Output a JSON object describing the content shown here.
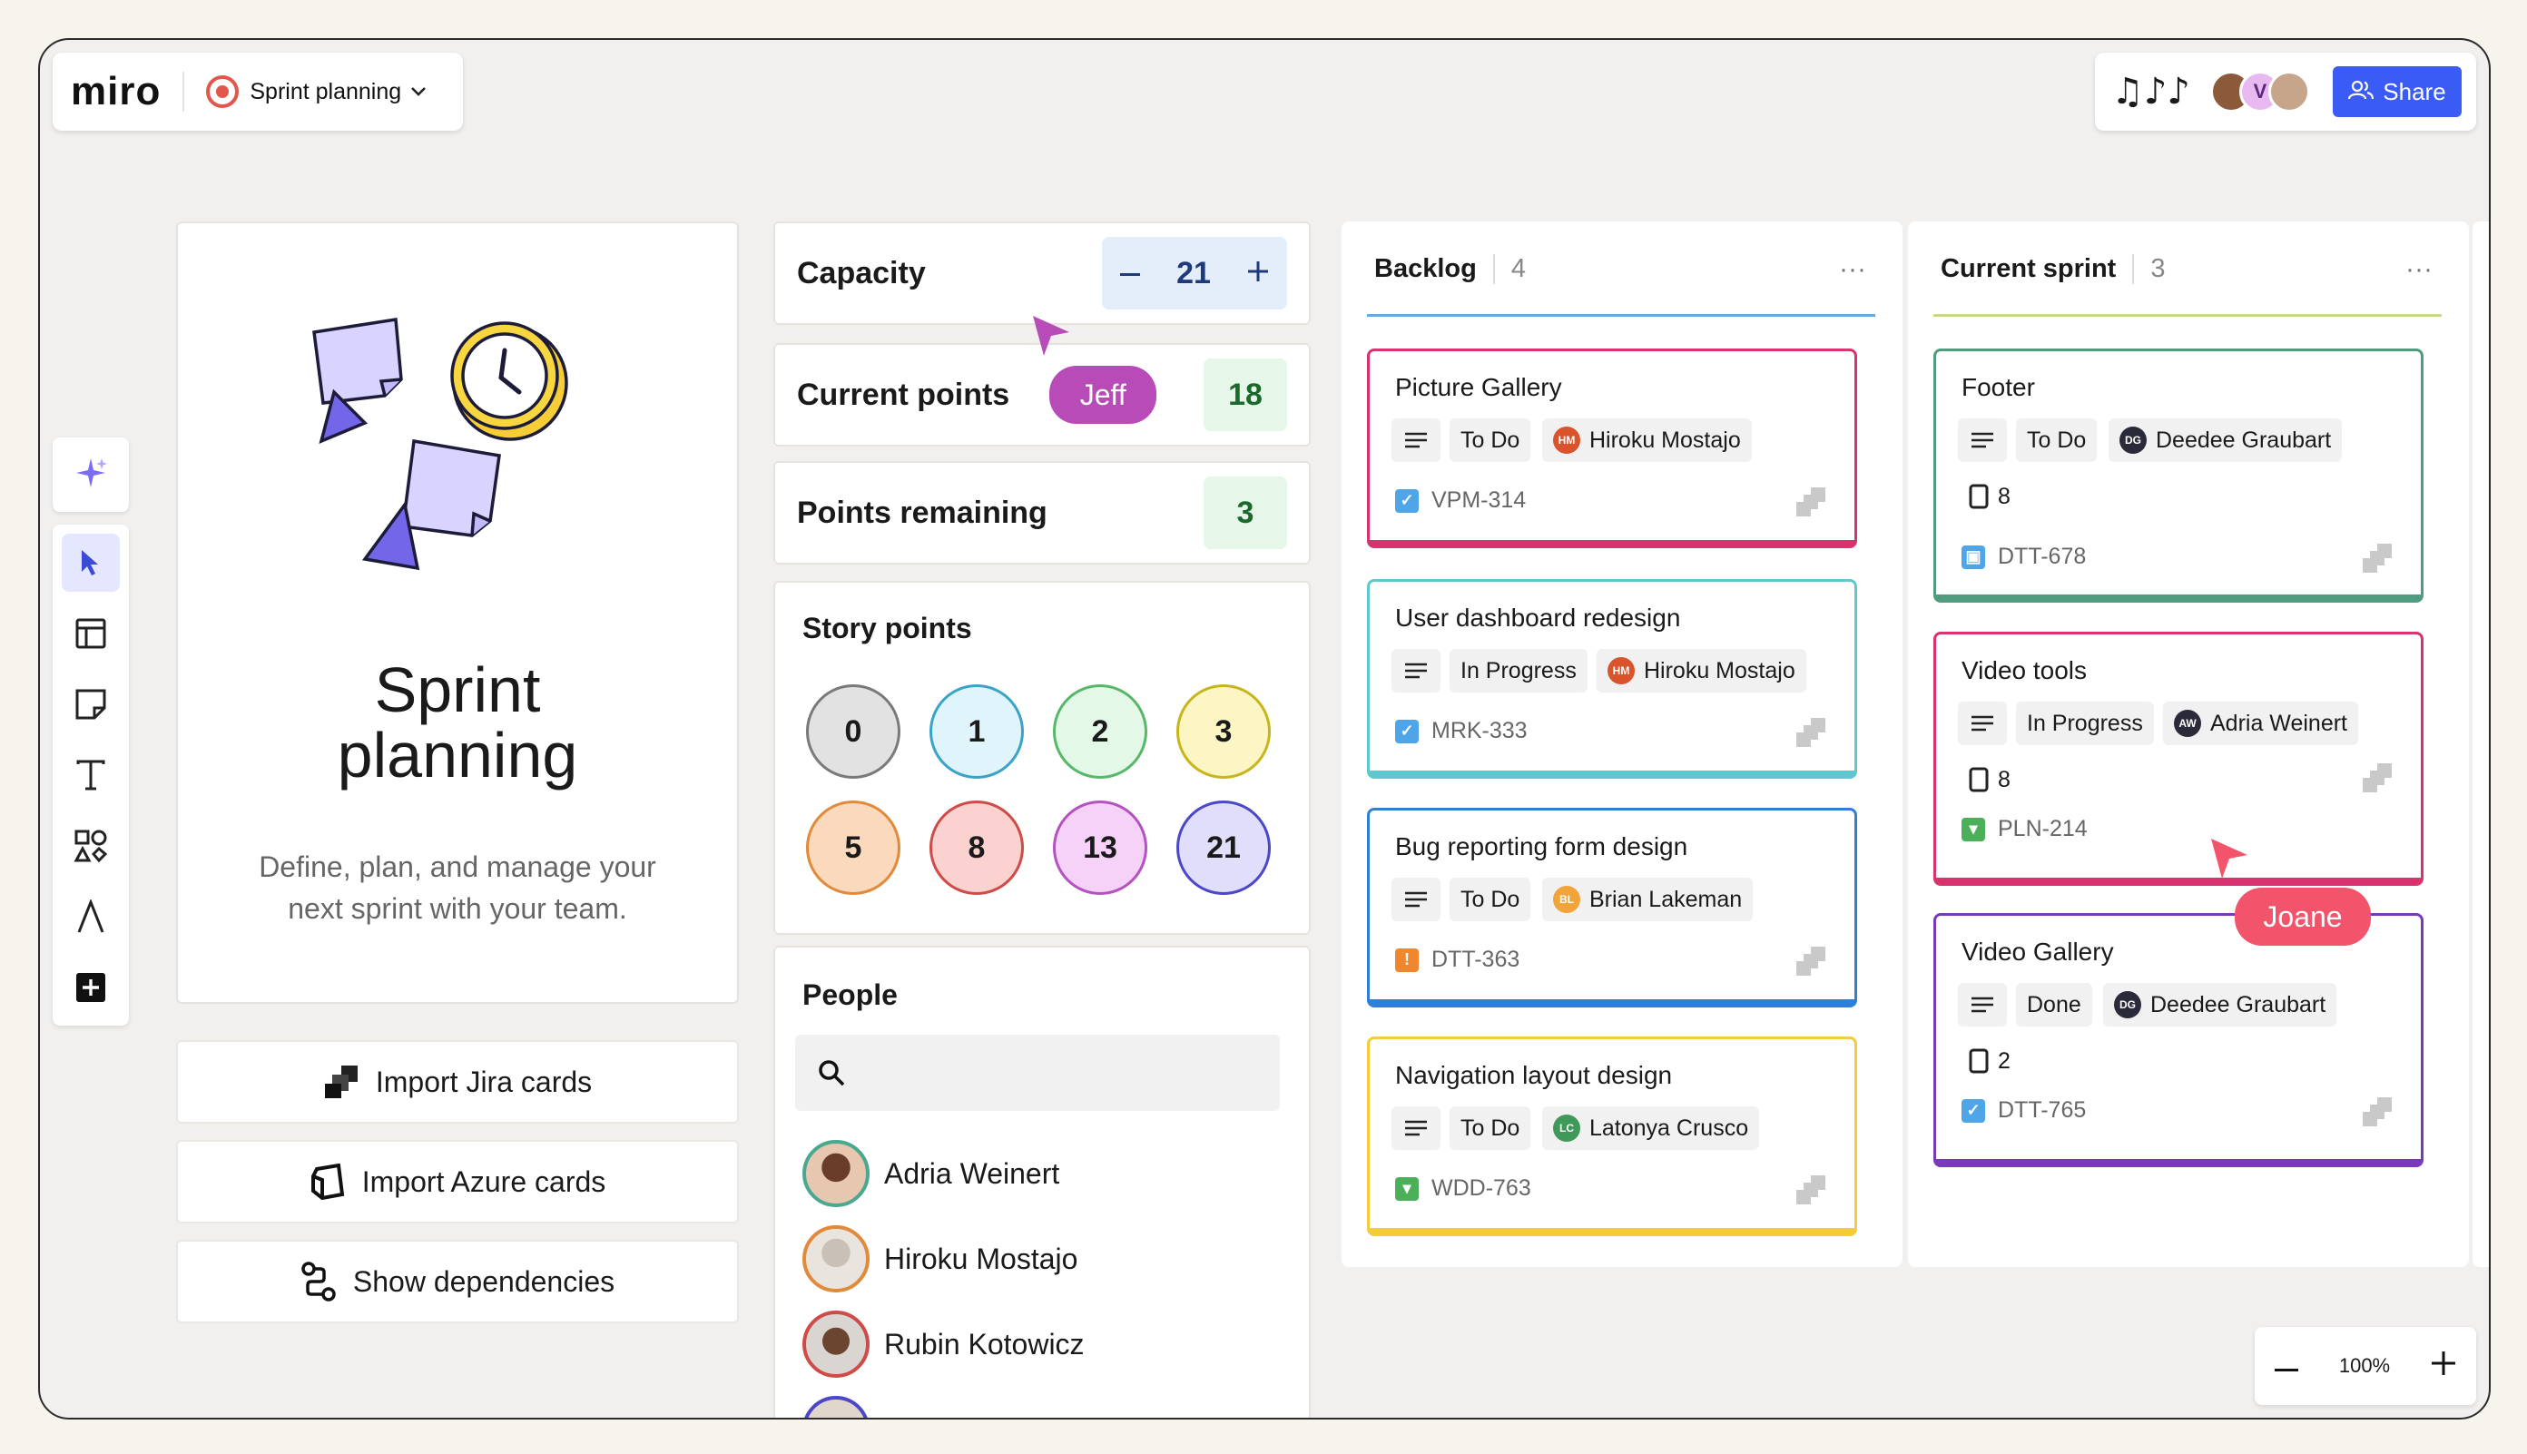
{
  "app": {
    "logo": "miro",
    "board_name": "Sprint planning"
  },
  "header": {
    "share_label": "Share",
    "avatar_v": "V",
    "signature": "♫♪♪"
  },
  "intro": {
    "title_line1": "Sprint",
    "title_line2": "planning",
    "description_line1": "Define, plan, and manage your",
    "description_line2": "next sprint with your team."
  },
  "actions": [
    {
      "label": "Import Jira cards",
      "icon": "jira-icon"
    },
    {
      "label": "Import Azure cards",
      "icon": "azure-icon"
    },
    {
      "label": "Show dependencies",
      "icon": "dependencies-icon"
    }
  ],
  "metrics": {
    "capacity_label": "Capacity",
    "capacity_value": "21",
    "current_points_label": "Current points",
    "current_points_user": "Jeff",
    "current_points_value": "18",
    "remaining_label": "Points remaining",
    "remaining_value": "3"
  },
  "story_points": {
    "title": "Story points",
    "values": [
      "0",
      "1",
      "2",
      "3",
      "5",
      "8",
      "13",
      "21"
    ]
  },
  "people": {
    "title": "People",
    "search_placeholder": "",
    "list": [
      "Adria Weinert",
      "Hiroku Mostajo",
      "Rubin Kotowicz"
    ]
  },
  "columns": [
    {
      "title": "Backlog",
      "count": "4",
      "cards": [
        {
          "title": "Picture Gallery",
          "status": "To Do",
          "assignee": "Hiroku Mostajo",
          "initials": "HM",
          "code": "VPM-314"
        },
        {
          "title": "User dashboard redesign",
          "status": "In Progress",
          "assignee": "Hiroku Mostajo",
          "initials": "HM",
          "code": "MRK-333"
        },
        {
          "title": "Bug reporting form design",
          "status": "To Do",
          "assignee": "Brian Lakeman",
          "initials": "BL",
          "code": "DTT-363"
        },
        {
          "title": "Navigation layout design",
          "status": "To Do",
          "assignee": "Latonya Crusco",
          "initials": "LC",
          "code": "WDD-763"
        }
      ]
    },
    {
      "title": "Current sprint",
      "count": "3",
      "cards": [
        {
          "title": "Footer",
          "status": "To Do",
          "assignee": "Deedee Graubart",
          "initials": "DG",
          "points": "8",
          "code": "DTT-678"
        },
        {
          "title": "Video tools",
          "status": "In Progress",
          "assignee": "Adria Weinert",
          "initials": "AW",
          "points": "8",
          "code": "PLN-214"
        },
        {
          "title": "Video Gallery",
          "status": "Done",
          "assignee": "Deedee Graubart",
          "initials": "DG",
          "points": "2",
          "code": "DTT-765"
        }
      ]
    }
  ],
  "cursors": {
    "joane": "Joane"
  },
  "zoom": {
    "level": "100%"
  },
  "colors": {
    "accent": "#3b5bf5",
    "jeff": "#b84bb8",
    "joane": "#f2556b"
  }
}
